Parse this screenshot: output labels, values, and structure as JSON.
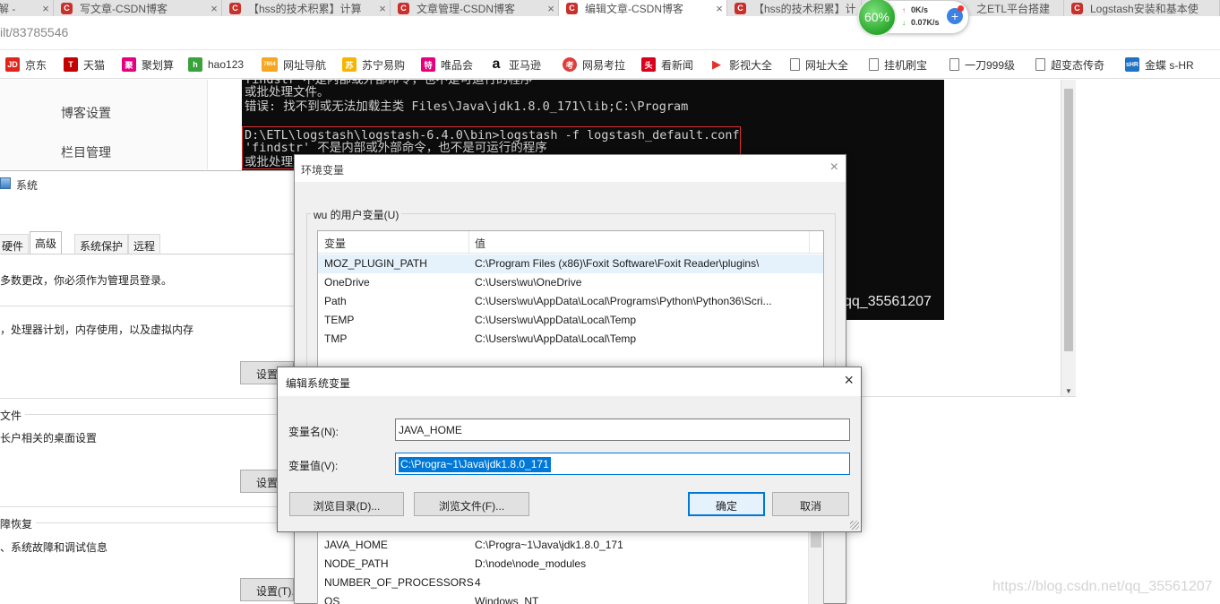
{
  "browser": {
    "tabs": [
      {
        "title": "解 - ",
        "fav": ""
      },
      {
        "title": "写文章-CSDN博客",
        "fav": "C"
      },
      {
        "title": "【hss的技术积累】计算",
        "fav": "C"
      },
      {
        "title": "文章管理-CSDN博客",
        "fav": "C"
      },
      {
        "title": "编辑文章-CSDN博客",
        "fav": "C"
      },
      {
        "title": "【hss的技术积累】计",
        "fav": "C"
      },
      {
        "title": "之ETL平台搭建",
        "fav": "C"
      },
      {
        "title": "Logstash安装和基本使",
        "fav": "C"
      }
    ],
    "tab_close": "×",
    "url": "ilt/83785546",
    "bookmarks": [
      {
        "label": "京东",
        "icon": "JD",
        "color": "#e1251b"
      },
      {
        "label": "天猫",
        "icon": "T",
        "color": "#c40000"
      },
      {
        "label": "聚划算",
        "icon": "聚",
        "color": "#e4007f"
      },
      {
        "label": "hao123",
        "icon": "h",
        "color": "#3aa23a"
      },
      {
        "label": "网址导航",
        "icon": "7654",
        "color": "#f5a623"
      },
      {
        "label": "苏宁易购",
        "icon": "苏",
        "color": "#f7b500"
      },
      {
        "label": "唯品会",
        "icon": "特",
        "color": "#e6007e"
      },
      {
        "label": "亚马逊",
        "icon": "a",
        "color": "#111111"
      },
      {
        "label": "网易考拉",
        "icon": "考",
        "color": "#e03c3c"
      },
      {
        "label": "看新闻",
        "icon": "头",
        "color": "#d9001b"
      },
      {
        "label": "影视大全",
        "icon": "▶",
        "color": "#e2322c"
      },
      {
        "label": "网址大全",
        "icon": "",
        "color": ""
      },
      {
        "label": "挂机刷宝",
        "icon": "",
        "color": ""
      },
      {
        "label": "一刀999级",
        "icon": "",
        "color": ""
      },
      {
        "label": "超变态传奇",
        "icon": "",
        "color": ""
      },
      {
        "label": "金蝶 s-HR",
        "icon": "sHR",
        "color": "#1f73c6"
      }
    ],
    "speed": {
      "percent": "60%",
      "up": "0K/s",
      "down": "0.07K/s",
      "plus": "+"
    }
  },
  "blog": {
    "nav": [
      "博客设置",
      "栏目管理"
    ],
    "console_lines": [
      "findstr 不是内部或外部命令，也不是可运行的程序",
      "或批处理文件。",
      "错误: 找不到或无法加载主类 Files\\Java\\jdk1.8.0_171\\lib;C:\\Program",
      "",
      "D:\\ETL\\logstash\\logstash-6.4.0\\bin>logstash -f logstash_default.conf",
      "'findstr' 不是内部或外部命令，也不是可运行的程序",
      "或批处理文件。"
    ],
    "watermark": "qq_35561207"
  },
  "system_properties": {
    "title": "系统",
    "tabs": [
      "硬件",
      "高级",
      "系统保护",
      "远程"
    ],
    "active_tab": "高级",
    "admin_note": "多数更改，你必须作为管理员登录。",
    "perf_desc": "，处理器计划，内存使用，以及虚拟内存",
    "profile_title": "文件",
    "profile_desc": "长户相关的桌面设置",
    "startup_title": "障恢复",
    "startup_desc": "、系统故障和调试信息",
    "btn_settings": "设置(S)...",
    "btn_settings2": "设置(E)...",
    "btn_settings3": "设置(T)..."
  },
  "env_vars": {
    "title": "环境变量",
    "close": "×",
    "user_group": "wu 的用户变量(U)",
    "col_name": "变量",
    "col_value": "值",
    "user_vars": [
      {
        "name": "MOZ_PLUGIN_PATH",
        "value": "C:\\Program Files (x86)\\Foxit Software\\Foxit Reader\\plugins\\"
      },
      {
        "name": "OneDrive",
        "value": "C:\\Users\\wu\\OneDrive"
      },
      {
        "name": "Path",
        "value": "C:\\Users\\wu\\AppData\\Local\\Programs\\Python\\Python36\\Scri..."
      },
      {
        "name": "TEMP",
        "value": "C:\\Users\\wu\\AppData\\Local\\Temp"
      },
      {
        "name": "TMP",
        "value": "C:\\Users\\wu\\AppData\\Local\\Temp"
      }
    ],
    "system_vars": [
      {
        "name": "JAVA_HOME",
        "value": "C:\\Progra~1\\Java\\jdk1.8.0_171"
      },
      {
        "name": "NODE_PATH",
        "value": "D:\\node\\node_modules"
      },
      {
        "name": "NUMBER_OF_PROCESSORS",
        "value": "4"
      },
      {
        "name": "OS",
        "value": "Windows_NT"
      }
    ]
  },
  "edit_dialog": {
    "title": "编辑系统变量",
    "close": "×",
    "name_label": "变量名(N):",
    "name_value": "JAVA_HOME",
    "value_label": "变量值(V):",
    "value_value": "C:\\Progra~1\\Java\\jdk1.8.0_171",
    "browse_dir": "浏览目录(D)...",
    "browse_file": "浏览文件(F)...",
    "ok": "确定",
    "cancel": "取消"
  },
  "footer_watermark": "https://blog.csdn.net/qq_35561207"
}
